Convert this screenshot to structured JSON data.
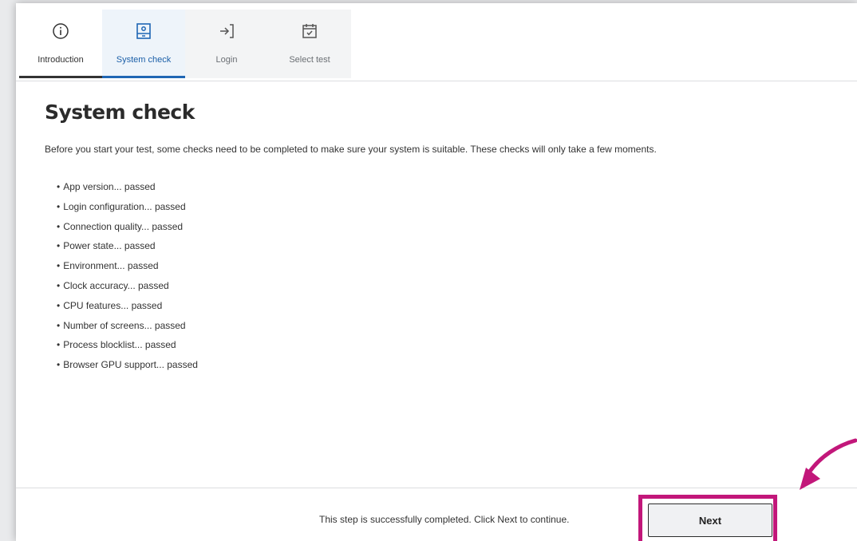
{
  "tabs": [
    {
      "label": "Introduction",
      "icon": "info-icon",
      "state": "done"
    },
    {
      "label": "System check",
      "icon": "computer-icon",
      "state": "active"
    },
    {
      "label": "Login",
      "icon": "login-arrow-icon",
      "state": "upcoming"
    },
    {
      "label": "Select test",
      "icon": "calendar-check-icon",
      "state": "upcoming"
    }
  ],
  "content": {
    "title": "System check",
    "intro": "Before you start your test, some checks need to be completed to make sure your system is suitable. These checks will only take a few moments.",
    "checks": [
      "App version... passed",
      "Login configuration... passed",
      "Connection quality... passed",
      "Power state... passed",
      "Environment... passed",
      "Clock accuracy... passed",
      "CPU features... passed",
      "Number of screens... passed",
      "Process blocklist... passed",
      "Browser GPU support... passed"
    ],
    "bullet": "•"
  },
  "footer": {
    "status_text": "This step is successfully completed. Click Next to continue.",
    "next_label": "Next"
  },
  "colors": {
    "accent": "#1f66b4",
    "highlight": "#c2177a",
    "text": "#333333"
  }
}
